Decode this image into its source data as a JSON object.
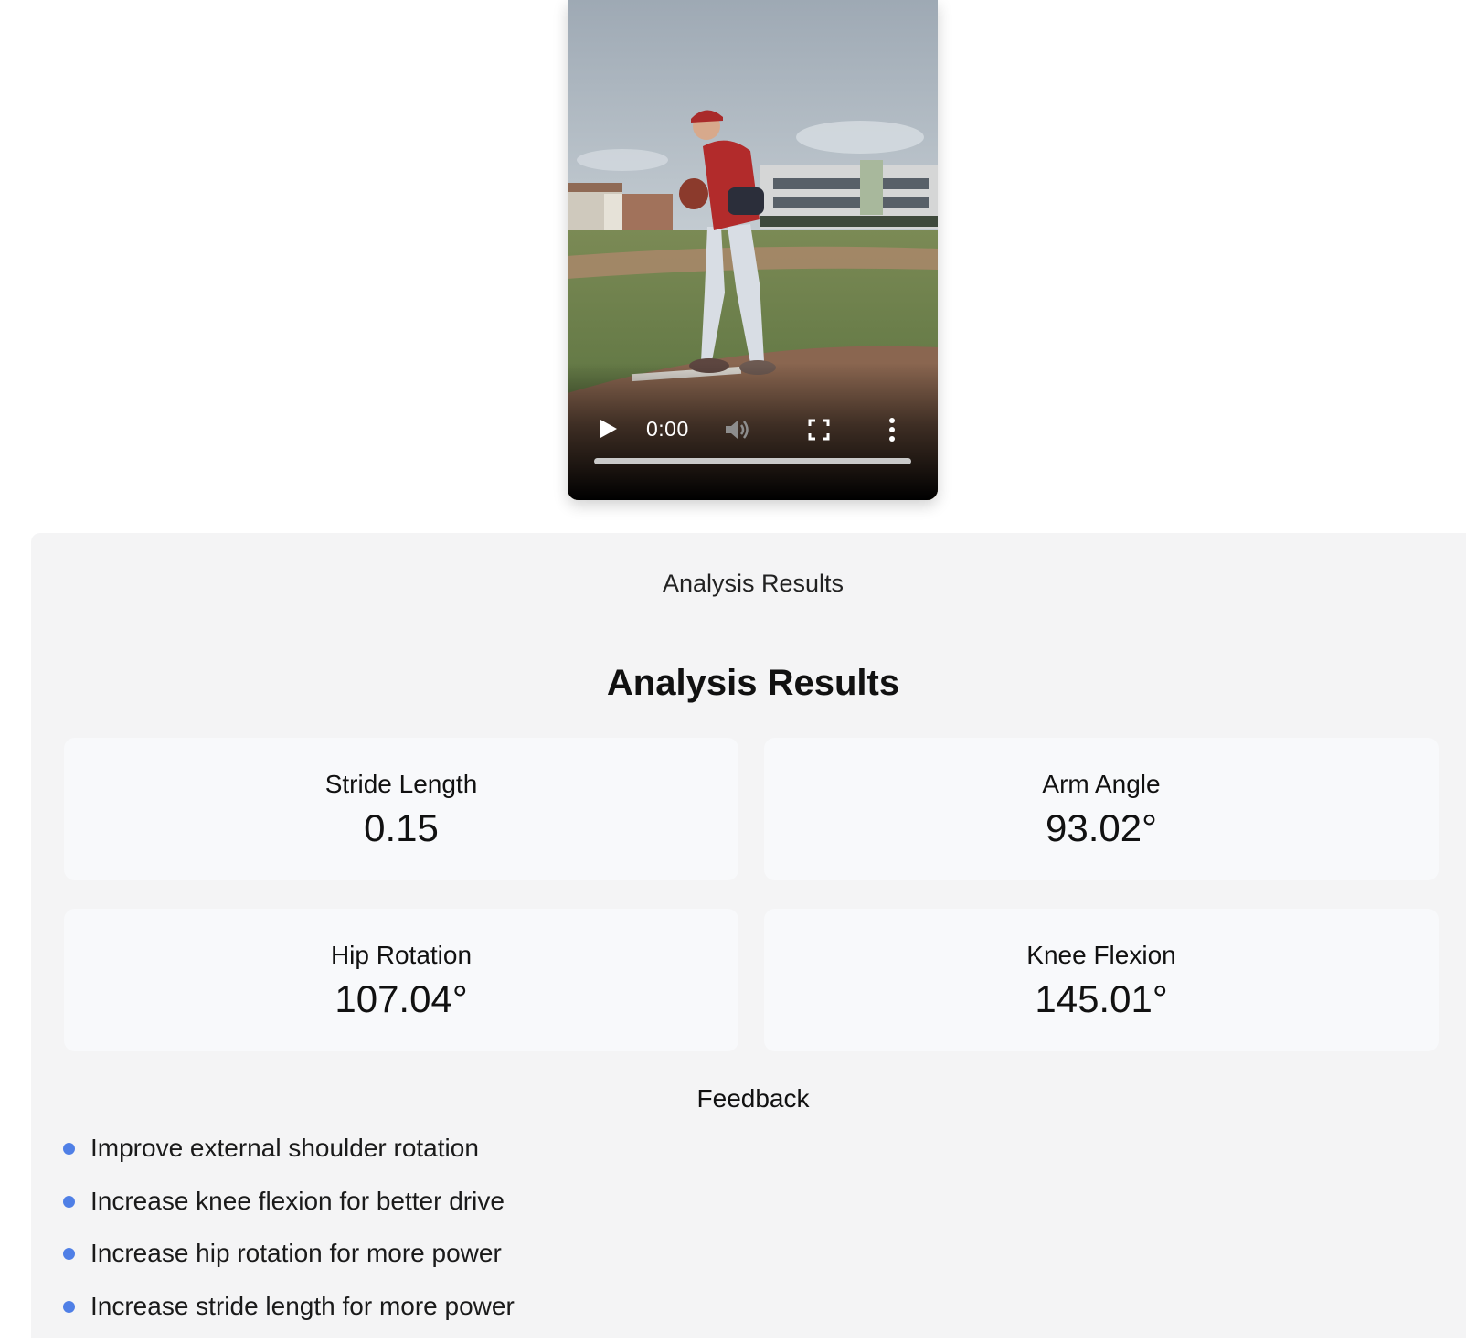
{
  "video": {
    "time": "0:00",
    "progress": 0,
    "icons": [
      "play-icon",
      "volume-icon",
      "fullscreen-icon",
      "more-vertical-icon"
    ]
  },
  "results": {
    "caption": "Analysis Results",
    "title": "Analysis Results",
    "metrics": [
      {
        "label": "Stride Length",
        "value": "0.15"
      },
      {
        "label": "Arm Angle",
        "value": "93.02°"
      },
      {
        "label": "Hip Rotation",
        "value": "107.04°"
      },
      {
        "label": "Knee Flexion",
        "value": "145.01°"
      }
    ],
    "feedback_title": "Feedback",
    "feedback": [
      "Improve external shoulder rotation",
      "Increase knee flexion for better drive",
      "Increase hip rotation for more power",
      "Increase stride length for more power"
    ]
  },
  "colors": {
    "panel_bg": "#f4f4f5",
    "card_bg": "#f8f9fb",
    "bullet": "#4f7fe6"
  }
}
